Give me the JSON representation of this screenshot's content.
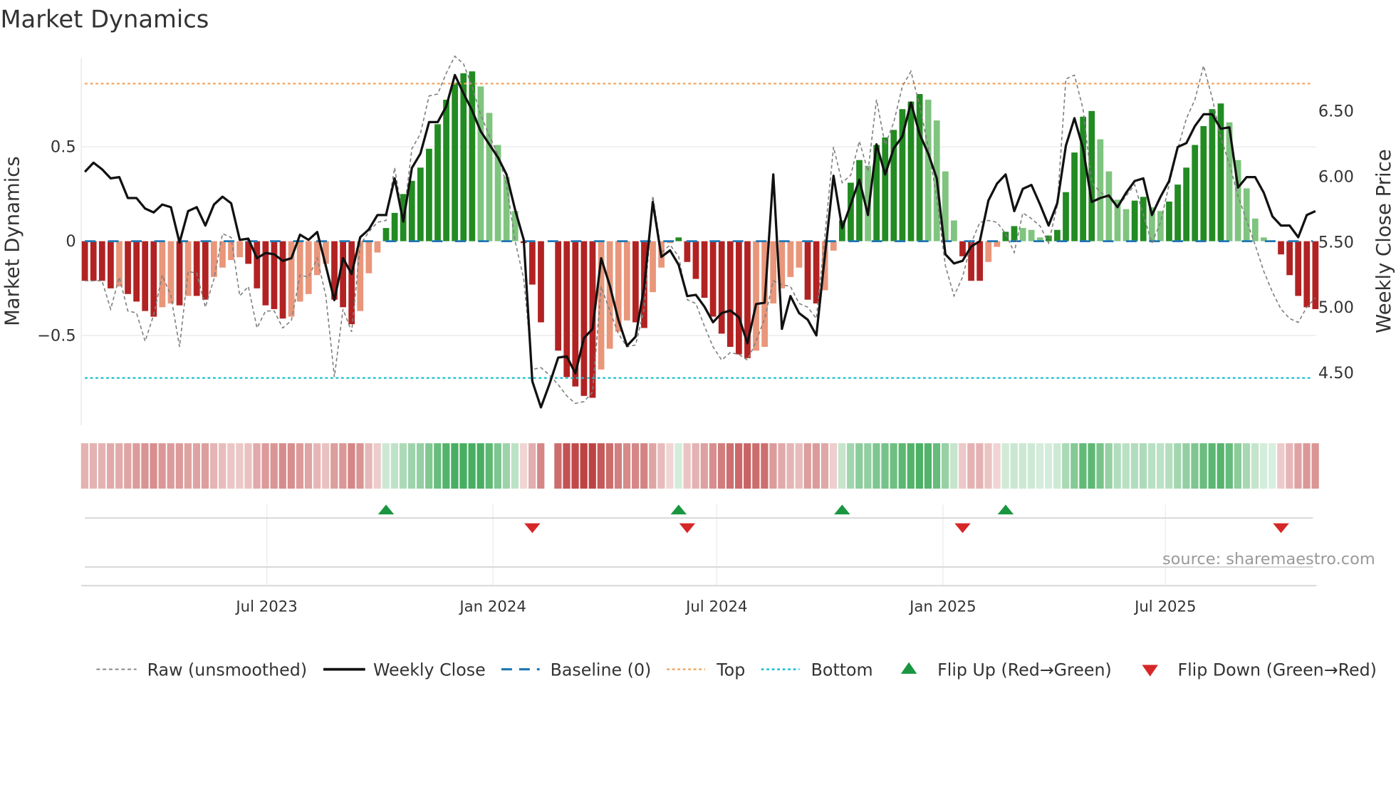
{
  "title": "Market Dynamics",
  "source": "source: sharemaestro.com",
  "legend": {
    "raw": "Raw (unsmoothed)",
    "close": "Weekly Close",
    "baseline": "Baseline (0)",
    "top": "Top",
    "bottom": "Bottom",
    "flip_up": "Flip Up (Red→Green)",
    "flip_down": "Flip Down (Green→Red)"
  },
  "colors": {
    "bar_neg_strong": "#b22222",
    "bar_neg_weak": "#e9967a",
    "bar_pos_strong": "#228b22",
    "bar_pos_weak": "#7fc47f",
    "raw": "#808080",
    "close": "#111111",
    "baseline": "#1f77b4",
    "top": "#f4a460",
    "bottom": "#17becf",
    "flip_up": "#1a9641",
    "flip_down": "#d62728",
    "strip_red": "178,34,34",
    "strip_green": "40,160,70"
  },
  "chart_data": {
    "type": "bar",
    "title": "Market Dynamics",
    "ylabel": "Market Dynamics",
    "ylabel_right": "Weekly Close Price",
    "ylim": [
      -0.98,
      0.97
    ],
    "ylim_right": [
      4.17,
      6.84
    ],
    "yticks": [
      {
        "v": 0.5,
        "label": "0.5"
      },
      {
        "v": 0,
        "label": "0"
      },
      {
        "v": -0.5,
        "label": "−0.5"
      }
    ],
    "yticks_right": [
      {
        "v": 6.5,
        "label": "6.50"
      },
      {
        "v": 6.0,
        "label": "6.00"
      },
      {
        "v": 5.5,
        "label": "5.50"
      },
      {
        "v": 5.0,
        "label": "5.00"
      },
      {
        "v": 4.5,
        "label": "4.50"
      }
    ],
    "xticks": [
      {
        "date": "2023-07-01",
        "label": "Jul 2023"
      },
      {
        "date": "2024-01-01",
        "label": "Jan 2024"
      },
      {
        "date": "2024-07-01",
        "label": "Jul 2024"
      },
      {
        "date": "2025-01-01",
        "label": "Jan 2025"
      },
      {
        "date": "2025-07-01",
        "label": "Jul 2025"
      }
    ],
    "start_date": "2023-02-03",
    "frequency": "weekly",
    "top_level": 0.835,
    "bottom_level": -0.725,
    "baseline": 0,
    "momentum": [
      -0.21,
      -0.21,
      -0.21,
      -0.25,
      -0.24,
      -0.28,
      -0.32,
      -0.37,
      -0.4,
      -0.35,
      -0.33,
      -0.34,
      -0.29,
      -0.29,
      -0.31,
      -0.19,
      -0.14,
      -0.1,
      -0.085,
      -0.12,
      -0.25,
      -0.34,
      -0.36,
      -0.41,
      -0.4,
      -0.32,
      -0.28,
      -0.18,
      -0.12,
      -0.31,
      -0.35,
      -0.44,
      -0.37,
      -0.17,
      -0.06,
      0.07,
      0.15,
      0.25,
      0.32,
      0.39,
      0.49,
      0.62,
      0.75,
      0.84,
      0.89,
      0.9,
      0.82,
      0.68,
      0.51,
      0.34,
      0.16,
      -0.01,
      -0.23,
      -0.43,
      null,
      -0.58,
      -0.72,
      -0.77,
      -0.82,
      -0.83,
      -0.68,
      -0.57,
      -0.48,
      -0.42,
      -0.43,
      -0.46,
      -0.27,
      -0.14,
      -0.01,
      0.02,
      -0.11,
      -0.2,
      -0.3,
      -0.4,
      -0.49,
      -0.56,
      -0.6,
      -0.62,
      -0.58,
      -0.56,
      -0.33,
      -0.25,
      -0.19,
      -0.14,
      -0.31,
      -0.33,
      -0.26,
      -0.05,
      0.11,
      0.31,
      0.43,
      0.4,
      0.51,
      0.55,
      0.59,
      0.7,
      0.74,
      0.78,
      0.75,
      0.64,
      0.37,
      0.11,
      -0.08,
      -0.21,
      -0.21,
      -0.11,
      -0.03,
      0.05,
      0.08,
      0.07,
      0.06,
      0.02,
      0.03,
      0.06,
      0.26,
      0.47,
      0.66,
      0.69,
      0.54,
      0.37,
      0.22,
      0.17,
      0.215,
      0.235,
      0.18,
      0.16,
      0.21,
      0.3,
      0.39,
      0.51,
      0.61,
      0.7,
      0.73,
      0.63,
      0.43,
      0.28,
      0.12,
      0.02,
      0.005,
      -0.07,
      -0.18,
      -0.29,
      -0.35,
      -0.36
    ],
    "raw": [
      -0.21,
      -0.21,
      -0.21,
      -0.36,
      -0.19,
      -0.37,
      -0.38,
      -0.53,
      -0.39,
      -0.18,
      -0.29,
      -0.56,
      -0.16,
      -0.17,
      -0.35,
      -0.2,
      0.04,
      0.02,
      -0.29,
      -0.24,
      -0.46,
      -0.37,
      -0.37,
      -0.46,
      -0.42,
      -0.18,
      -0.19,
      -0.09,
      -0.29,
      -0.72,
      -0.36,
      -0.48,
      -0.02,
      0.05,
      0.1,
      0.11,
      0.39,
      0.11,
      0.49,
      0.57,
      0.77,
      0.78,
      0.89,
      0.98,
      0.94,
      0.82,
      0.67,
      0.56,
      0.46,
      0.3,
      0.0,
      -0.2,
      -0.68,
      -0.67,
      -0.71,
      -0.76,
      -0.82,
      -0.86,
      -0.85,
      -0.8,
      -0.24,
      -0.37,
      -0.49,
      -0.56,
      -0.55,
      -0.36,
      0.24,
      -0.06,
      -0.02,
      -0.08,
      -0.31,
      -0.33,
      -0.45,
      -0.56,
      -0.63,
      -0.59,
      -0.6,
      -0.63,
      -0.53,
      -0.41,
      -0.21,
      -0.23,
      -0.24,
      -0.33,
      -0.35,
      -0.41,
      0.03,
      0.5,
      0.31,
      0.35,
      0.53,
      0.37,
      0.75,
      0.51,
      0.63,
      0.82,
      0.9,
      0.72,
      0.5,
      0.23,
      -0.13,
      -0.29,
      -0.19,
      -0.01,
      0.1,
      0.11,
      0.1,
      0.04,
      -0.06,
      0.15,
      0.12,
      0.08,
      -0.01,
      0.19,
      0.86,
      0.88,
      0.7,
      0.31,
      0.26,
      0.23,
      0.18,
      0.24,
      0.3,
      0.14,
      -0.01,
      0.1,
      0.3,
      0.49,
      0.65,
      0.75,
      0.93,
      0.76,
      0.55,
      0.41,
      0.24,
      0.11,
      -0.02,
      -0.16,
      -0.27,
      -0.36,
      -0.41,
      -0.43,
      -0.35,
      -0.3
    ],
    "close": [
      6.03,
      6.1,
      6.05,
      5.98,
      5.99,
      5.83,
      5.83,
      5.75,
      5.72,
      5.78,
      5.76,
      5.49,
      5.73,
      5.76,
      5.62,
      5.78,
      5.84,
      5.79,
      5.51,
      5.52,
      5.37,
      5.41,
      5.4,
      5.35,
      5.37,
      5.55,
      5.51,
      5.57,
      5.31,
      5.05,
      5.37,
      5.25,
      5.53,
      5.59,
      5.7,
      5.7,
      5.98,
      5.65,
      6.06,
      6.17,
      6.41,
      6.41,
      6.53,
      6.77,
      6.63,
      6.5,
      6.34,
      6.24,
      6.14,
      6.01,
      5.74,
      5.51,
      4.43,
      4.23,
      4.41,
      4.61,
      4.62,
      4.49,
      4.76,
      4.83,
      5.37,
      5.16,
      4.9,
      4.7,
      4.77,
      5.15,
      5.8,
      5.38,
      5.43,
      5.32,
      5.08,
      5.09,
      5.0,
      4.88,
      4.95,
      4.97,
      4.92,
      4.72,
      5.02,
      5.03,
      6.01,
      4.83,
      5.08,
      4.95,
      4.9,
      4.78,
      5.39,
      6.0,
      5.6,
      5.78,
      5.97,
      5.7,
      6.24,
      6.01,
      6.21,
      6.3,
      6.56,
      6.32,
      6.17,
      5.98,
      5.4,
      5.33,
      5.35,
      5.46,
      5.5,
      5.81,
      5.94,
      6.01,
      5.73,
      5.9,
      5.93,
      5.78,
      5.62,
      5.79,
      6.23,
      6.44,
      6.21,
      5.8,
      5.83,
      5.85,
      5.76,
      5.87,
      5.96,
      5.98,
      5.7,
      5.84,
      5.96,
      6.22,
      6.25,
      6.38,
      6.47,
      6.47,
      6.36,
      6.37,
      5.91,
      5.99,
      5.99,
      5.87,
      5.69,
      5.62,
      5.62,
      5.53,
      5.7,
      5.73
    ],
    "flips_up": [
      "2023-10-06",
      "2024-05-31",
      "2024-10-11",
      "2025-02-21"
    ],
    "flips_down": [
      "2024-02-02",
      "2024-06-07",
      "2025-01-17",
      "2025-10-03"
    ],
    "legend_position": "bottom"
  }
}
